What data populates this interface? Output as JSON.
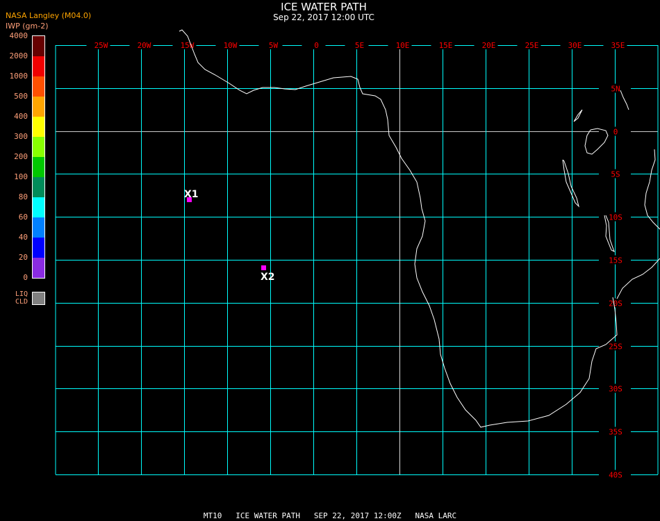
{
  "header": {
    "title": "ICE WATER PATH",
    "subtitle": "Sep 22, 2017 12:00 UTC",
    "org": "NASA Langley (M04.0)",
    "units": "IWP (gm-2)"
  },
  "legend": {
    "labels": [
      "4000",
      "2000",
      "1000",
      "500",
      "400",
      "300",
      "200",
      "100",
      "80",
      "60",
      "40",
      "20",
      "0"
    ],
    "colors": [
      "#660000",
      "#f00000",
      "#ff5000",
      "#ffa500",
      "#ffff00",
      "#88ff00",
      "#00c800",
      "#008c5a",
      "#00ffff",
      "#0080ff",
      "#0000ff",
      "#8a2be2"
    ],
    "liq_label_1": "LIQ",
    "liq_label_2": "CLD",
    "liq_color": "#808080"
  },
  "grid": {
    "lon_labels": [
      "25W",
      "20W",
      "15W",
      "10W",
      "5W",
      "0",
      "5E",
      "10E",
      "15E",
      "20E",
      "25E",
      "30E",
      "35E"
    ],
    "lat_labels": [
      "5N",
      "0",
      "5S",
      "10S",
      "15S",
      "20S",
      "25S",
      "30S",
      "35S",
      "40S"
    ],
    "grid_color": "#00ffff",
    "label_color": "#ff0000"
  },
  "markers": [
    {
      "label": "X1",
      "color": "#ff00ff"
    },
    {
      "label": "X2",
      "color": "#ff00ff"
    }
  ],
  "footer": "MT10   ICE WATER PATH   SEP 22, 2017 12:00Z   NASA LARC"
}
